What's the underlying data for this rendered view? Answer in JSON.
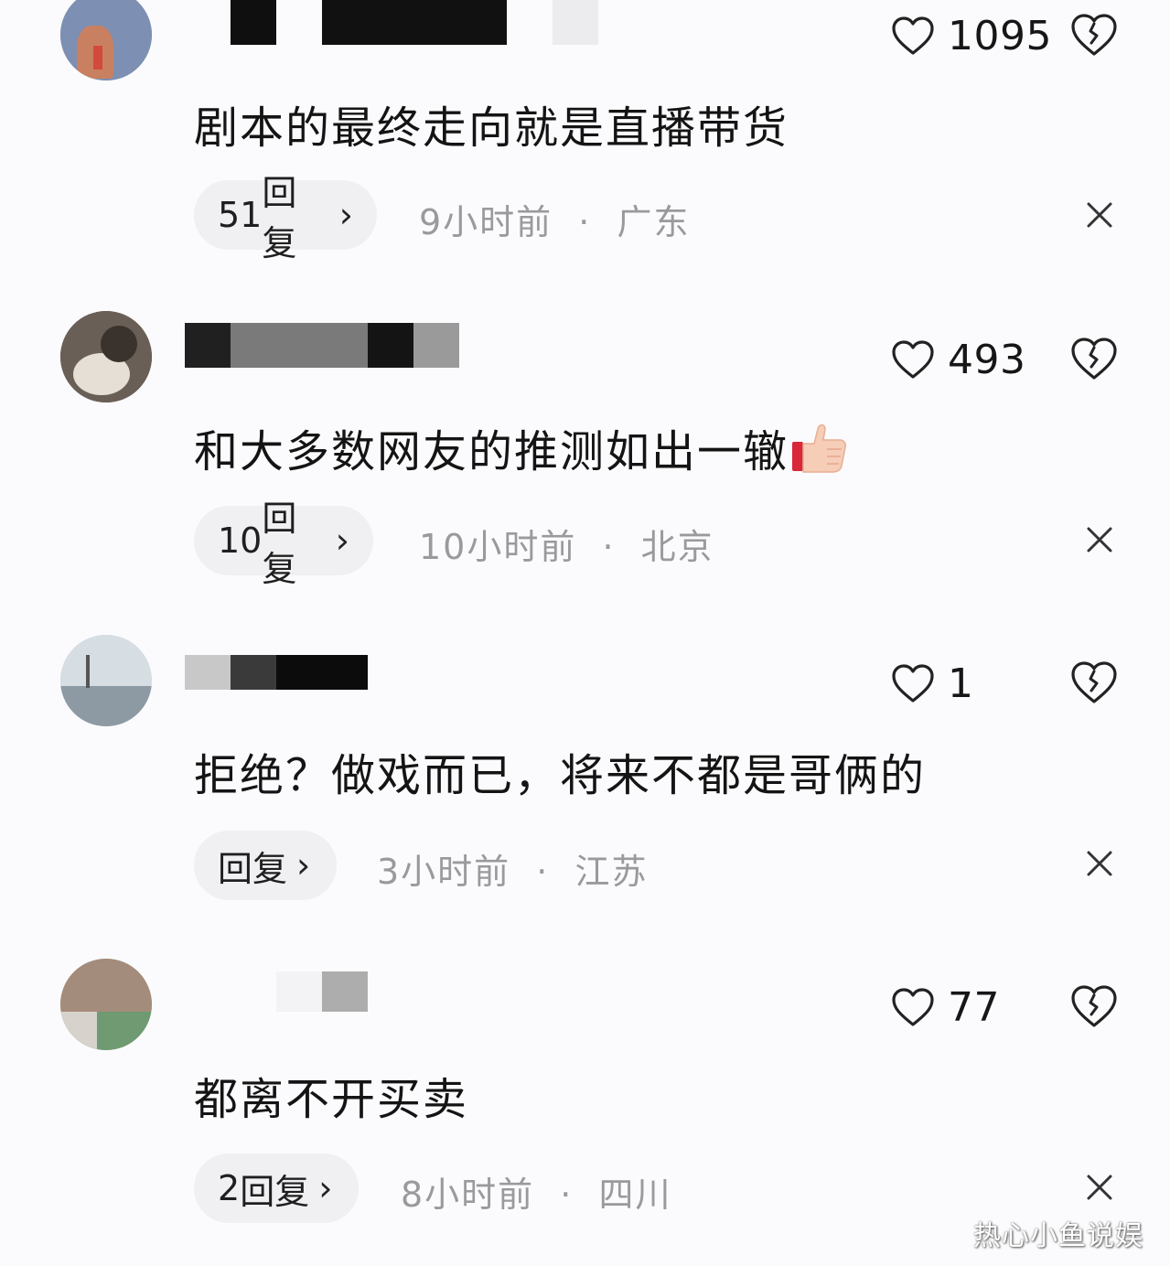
{
  "comments": [
    {
      "likes": "1095",
      "text": "剧本的最终走向就是直播带货",
      "reply_count": "51",
      "reply_label": "回复",
      "time": "9小时前",
      "location": "广东"
    },
    {
      "likes": "493",
      "text": "和大多数网友的推测如出一辙",
      "reply_count": "10",
      "reply_label": "回复",
      "time": "10小时前",
      "location": "北京"
    },
    {
      "likes": "1",
      "text": "拒绝？做戏而已，将来不都是哥俩的",
      "reply_count": "",
      "reply_label": "回复",
      "time": "3小时前",
      "location": "江苏"
    },
    {
      "likes": "77",
      "text": "都离不开买卖",
      "reply_count": "2",
      "reply_label": "回复",
      "time": "8小时前",
      "location": "四川"
    }
  ],
  "separator": "·",
  "chevron": "›",
  "watermark": "热心小鱼说娱",
  "icons": {
    "like": "heart-outline-icon",
    "dislike": "broken-heart-icon",
    "close": "close-icon",
    "chevron": "chevron-right-icon",
    "thumbs_up_emoji": "thumbs-up-emoji"
  },
  "colors": {
    "background": "#fbfbfd",
    "text": "#141414",
    "meta": "#9a9a9e",
    "pill": "#f0f0f3"
  }
}
